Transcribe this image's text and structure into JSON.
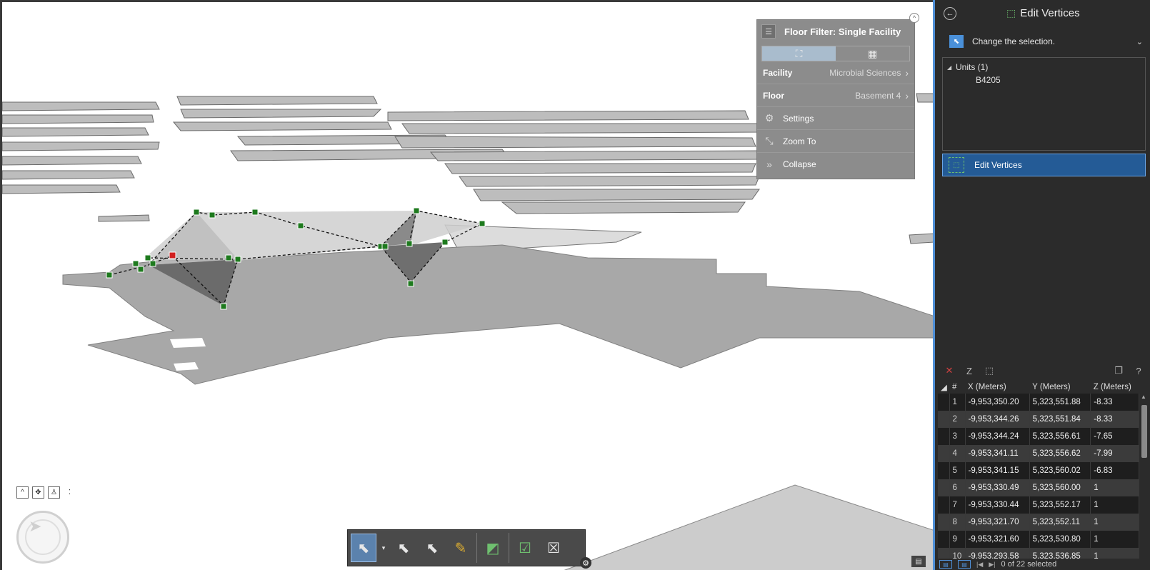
{
  "floor_filter": {
    "title": "Floor Filter: Single Facility",
    "facility_label": "Facility",
    "facility_value": "Microbial Sciences",
    "floor_label": "Floor",
    "floor_value": "Basement 4",
    "settings_label": "Settings",
    "zoom_label": "Zoom To",
    "collapse_label": "Collapse"
  },
  "pane": {
    "title": "Edit Vertices",
    "instruction": "Change the selection.",
    "tree": {
      "parent": "Units (1)",
      "child": "B4205"
    },
    "tool_label": "Edit Vertices"
  },
  "vertex_table": {
    "headers": [
      "#",
      "X (Meters)",
      "Y (Meters)",
      "Z (Meters)"
    ],
    "rows": [
      [
        "1",
        "-9,953,350.20",
        "5,323,551.88",
        "-8.33"
      ],
      [
        "2",
        "-9,953,344.26",
        "5,323,551.84",
        "-8.33"
      ],
      [
        "3",
        "-9,953,344.24",
        "5,323,556.61",
        "-7.65"
      ],
      [
        "4",
        "-9,953,341.11",
        "5,323,556.62",
        "-7.99"
      ],
      [
        "5",
        "-9,953,341.15",
        "5,323,560.02",
        "-6.83"
      ],
      [
        "6",
        "-9,953,330.49",
        "5,323,560.00",
        "1"
      ],
      [
        "7",
        "-9,953,330.44",
        "5,323,552.17",
        "1"
      ],
      [
        "8",
        "-9,953,321.70",
        "5,323,552.11",
        "1"
      ],
      [
        "9",
        "-9,953,321.60",
        "5,323,530.80",
        "1"
      ],
      [
        "10",
        "-9,953,293.58",
        "5,323,536.85",
        "1"
      ]
    ]
  },
  "status": {
    "selection_text": "0 of 22 selected"
  },
  "colors": {
    "accent": "#4f8fd6",
    "vertex_green": "#1e7a1e",
    "vertex_red": "#d11f1f"
  }
}
